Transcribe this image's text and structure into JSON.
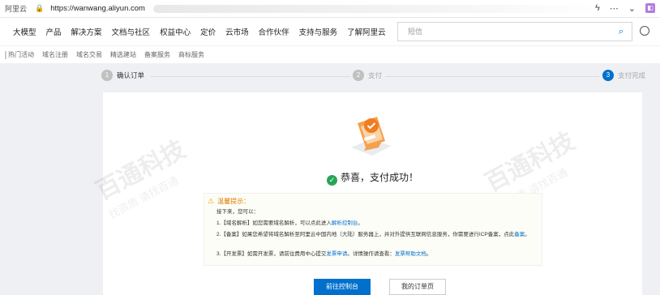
{
  "browser": {
    "site_label": "阿里云",
    "url": "https://wanwang.aliyun.com"
  },
  "topnav": {
    "items": [
      "大模型",
      "产品",
      "解决方案",
      "文档与社区",
      "权益中心",
      "定价",
      "云市场",
      "合作伙伴",
      "支持与服务",
      "了解阿里云"
    ],
    "search_placeholder": "短信"
  },
  "subnav": {
    "items": [
      "热门活动",
      "域名注册",
      "域名交易",
      "精选建站",
      "备案服务",
      "商标服务"
    ]
  },
  "steps": [
    {
      "num": "1",
      "label": "确认订单"
    },
    {
      "num": "2",
      "label": "支付"
    },
    {
      "num": "3",
      "label": "支付完成"
    }
  ],
  "watermark": {
    "title": "百通科技",
    "subtitle": "找资质 请找百通"
  },
  "success_message": "恭喜，支付成功！",
  "tip": {
    "title": "温馨提示：",
    "intro": "接下来，您可以：",
    "line1": "1.【域名解析】如您需要域名解析，可以点此进入",
    "line1_link": "解析控制台",
    "line1_tail": "。",
    "line2": "2.【备案】如果您希望将域名解析至阿里云中国内地（大陆）服务器上，并对外提供互联网信息服务，你需要进行ICP备案，点此",
    "line2_link": "备案",
    "line2_tail": "。",
    "line3": "3.【开发票】如需开发票，请前往费用中心提交",
    "line3_link1": "发票申请",
    "line3_mid": "。详情操作请查看：",
    "line3_link2": "发票帮助文档",
    "line3_tail": "。"
  },
  "buttons": {
    "console": "前往控制台",
    "orders": "我的订单页"
  }
}
